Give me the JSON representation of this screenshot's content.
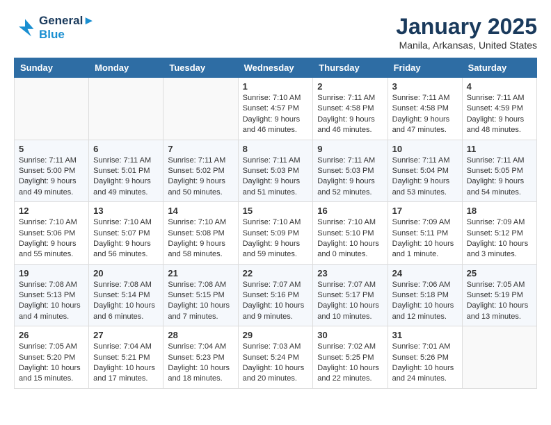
{
  "logo": {
    "line1": "General",
    "line2": "Blue"
  },
  "title": "January 2025",
  "location": "Manila, Arkansas, United States",
  "days_header": [
    "Sunday",
    "Monday",
    "Tuesday",
    "Wednesday",
    "Thursday",
    "Friday",
    "Saturday"
  ],
  "weeks": [
    [
      {
        "day": "",
        "info": ""
      },
      {
        "day": "",
        "info": ""
      },
      {
        "day": "",
        "info": ""
      },
      {
        "day": "1",
        "info": "Sunrise: 7:10 AM\nSunset: 4:57 PM\nDaylight: 9 hours and 46 minutes."
      },
      {
        "day": "2",
        "info": "Sunrise: 7:11 AM\nSunset: 4:58 PM\nDaylight: 9 hours and 46 minutes."
      },
      {
        "day": "3",
        "info": "Sunrise: 7:11 AM\nSunset: 4:58 PM\nDaylight: 9 hours and 47 minutes."
      },
      {
        "day": "4",
        "info": "Sunrise: 7:11 AM\nSunset: 4:59 PM\nDaylight: 9 hours and 48 minutes."
      }
    ],
    [
      {
        "day": "5",
        "info": "Sunrise: 7:11 AM\nSunset: 5:00 PM\nDaylight: 9 hours and 49 minutes."
      },
      {
        "day": "6",
        "info": "Sunrise: 7:11 AM\nSunset: 5:01 PM\nDaylight: 9 hours and 49 minutes."
      },
      {
        "day": "7",
        "info": "Sunrise: 7:11 AM\nSunset: 5:02 PM\nDaylight: 9 hours and 50 minutes."
      },
      {
        "day": "8",
        "info": "Sunrise: 7:11 AM\nSunset: 5:03 PM\nDaylight: 9 hours and 51 minutes."
      },
      {
        "day": "9",
        "info": "Sunrise: 7:11 AM\nSunset: 5:03 PM\nDaylight: 9 hours and 52 minutes."
      },
      {
        "day": "10",
        "info": "Sunrise: 7:11 AM\nSunset: 5:04 PM\nDaylight: 9 hours and 53 minutes."
      },
      {
        "day": "11",
        "info": "Sunrise: 7:11 AM\nSunset: 5:05 PM\nDaylight: 9 hours and 54 minutes."
      }
    ],
    [
      {
        "day": "12",
        "info": "Sunrise: 7:10 AM\nSunset: 5:06 PM\nDaylight: 9 hours and 55 minutes."
      },
      {
        "day": "13",
        "info": "Sunrise: 7:10 AM\nSunset: 5:07 PM\nDaylight: 9 hours and 56 minutes."
      },
      {
        "day": "14",
        "info": "Sunrise: 7:10 AM\nSunset: 5:08 PM\nDaylight: 9 hours and 58 minutes."
      },
      {
        "day": "15",
        "info": "Sunrise: 7:10 AM\nSunset: 5:09 PM\nDaylight: 9 hours and 59 minutes."
      },
      {
        "day": "16",
        "info": "Sunrise: 7:10 AM\nSunset: 5:10 PM\nDaylight: 10 hours and 0 minutes."
      },
      {
        "day": "17",
        "info": "Sunrise: 7:09 AM\nSunset: 5:11 PM\nDaylight: 10 hours and 1 minute."
      },
      {
        "day": "18",
        "info": "Sunrise: 7:09 AM\nSunset: 5:12 PM\nDaylight: 10 hours and 3 minutes."
      }
    ],
    [
      {
        "day": "19",
        "info": "Sunrise: 7:08 AM\nSunset: 5:13 PM\nDaylight: 10 hours and 4 minutes."
      },
      {
        "day": "20",
        "info": "Sunrise: 7:08 AM\nSunset: 5:14 PM\nDaylight: 10 hours and 6 minutes."
      },
      {
        "day": "21",
        "info": "Sunrise: 7:08 AM\nSunset: 5:15 PM\nDaylight: 10 hours and 7 minutes."
      },
      {
        "day": "22",
        "info": "Sunrise: 7:07 AM\nSunset: 5:16 PM\nDaylight: 10 hours and 9 minutes."
      },
      {
        "day": "23",
        "info": "Sunrise: 7:07 AM\nSunset: 5:17 PM\nDaylight: 10 hours and 10 minutes."
      },
      {
        "day": "24",
        "info": "Sunrise: 7:06 AM\nSunset: 5:18 PM\nDaylight: 10 hours and 12 minutes."
      },
      {
        "day": "25",
        "info": "Sunrise: 7:05 AM\nSunset: 5:19 PM\nDaylight: 10 hours and 13 minutes."
      }
    ],
    [
      {
        "day": "26",
        "info": "Sunrise: 7:05 AM\nSunset: 5:20 PM\nDaylight: 10 hours and 15 minutes."
      },
      {
        "day": "27",
        "info": "Sunrise: 7:04 AM\nSunset: 5:21 PM\nDaylight: 10 hours and 17 minutes."
      },
      {
        "day": "28",
        "info": "Sunrise: 7:04 AM\nSunset: 5:23 PM\nDaylight: 10 hours and 18 minutes."
      },
      {
        "day": "29",
        "info": "Sunrise: 7:03 AM\nSunset: 5:24 PM\nDaylight: 10 hours and 20 minutes."
      },
      {
        "day": "30",
        "info": "Sunrise: 7:02 AM\nSunset: 5:25 PM\nDaylight: 10 hours and 22 minutes."
      },
      {
        "day": "31",
        "info": "Sunrise: 7:01 AM\nSunset: 5:26 PM\nDaylight: 10 hours and 24 minutes."
      },
      {
        "day": "",
        "info": ""
      }
    ]
  ]
}
